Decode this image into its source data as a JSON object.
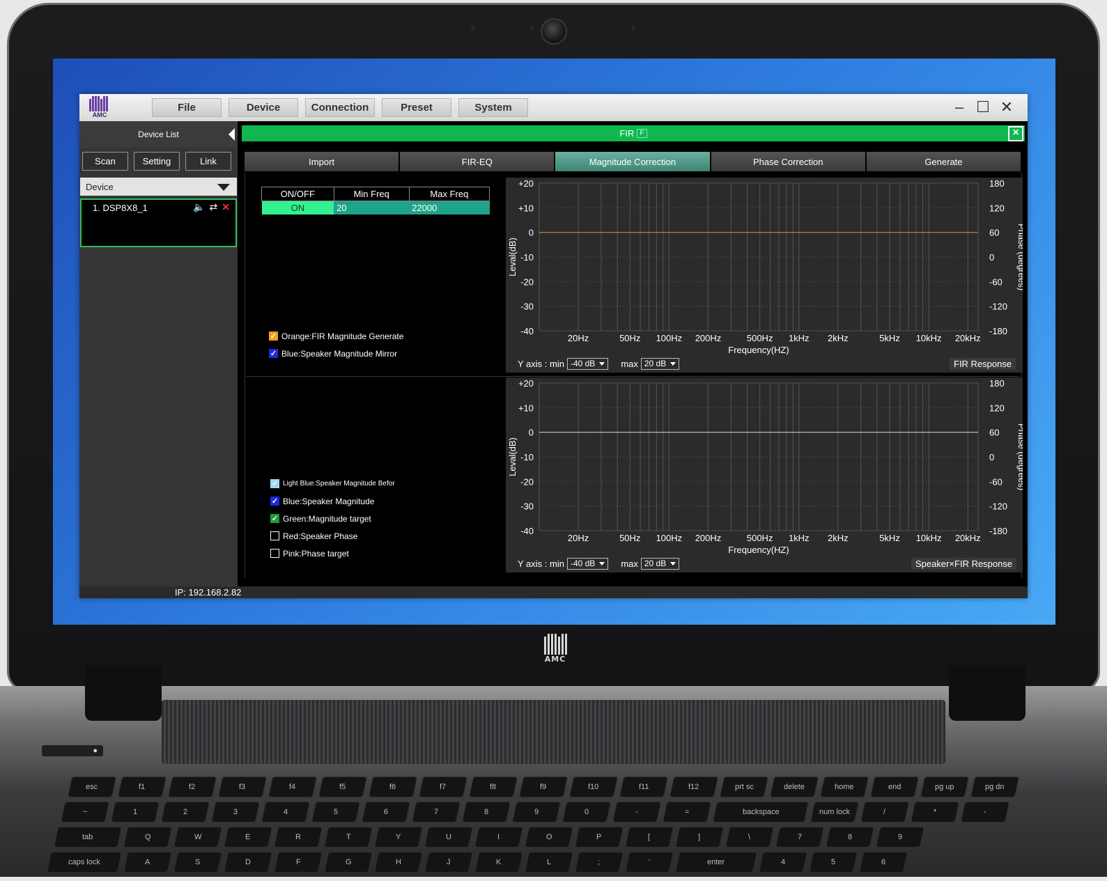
{
  "app": {
    "logo_text": "AMC",
    "menu": [
      "File",
      "Device",
      "Connection",
      "Preset",
      "System"
    ]
  },
  "sidebar": {
    "title": "Device List",
    "buttons": [
      "Scan",
      "Setting",
      "Link"
    ],
    "device_select": "Device",
    "device_name": "1. DSP8X8_1",
    "ip": "IP: 192.168.2.82"
  },
  "fir": {
    "title": "FIR",
    "badge": "F",
    "tabs": [
      "Import",
      "FIR-EQ",
      "Magnitude Correction",
      "Phase Correction",
      "Generate"
    ],
    "active_tab": "Magnitude Correction",
    "table": {
      "headers": [
        "ON/OFF",
        "Min Freq",
        "Max Freq"
      ],
      "row": [
        "ON",
        "20",
        "22000"
      ]
    },
    "legend_top": [
      {
        "label": "Orange:FIR Magnitude Generate",
        "checked": true,
        "color": "#f0a020"
      },
      {
        "label": "Blue:Speaker Magnitude Mirror",
        "checked": true,
        "color": "#1a2be0"
      }
    ],
    "legend_bottom": [
      {
        "label": "Light Blue:Speaker Magnitude Befor",
        "checked": true,
        "color": "#9fd8ee"
      },
      {
        "label": "Blue:Speaker Magnitude",
        "checked": true,
        "color": "#1a2be0"
      },
      {
        "label": "Green:Magnitude target",
        "checked": true,
        "color": "#1c9a3a"
      },
      {
        "label": "Red:Speaker Phase",
        "checked": false,
        "color": "#000000"
      },
      {
        "label": "Pink:Phase target",
        "checked": false,
        "color": "#000000"
      }
    ],
    "y_axis": {
      "label": "Y axis : min",
      "min": "-40 dB",
      "max_label": "max",
      "max": "20 dB"
    },
    "top_response": "FIR Response",
    "bottom_response": "Speaker×FIR Response"
  },
  "chart_data": [
    {
      "type": "line",
      "title": "",
      "xlabel": "Frequency(HZ)",
      "ylabel": "Leval(dB)",
      "y2label": "Phase (degrees)",
      "x_ticks": [
        "20Hz",
        "50Hz",
        "100Hz",
        "200Hz",
        "500Hz",
        "1kHz",
        "2kHz",
        "5kHz",
        "10kHz",
        "20kHz"
      ],
      "x_tick_values": [
        20,
        50,
        100,
        200,
        500,
        1000,
        2000,
        5000,
        10000,
        20000
      ],
      "y_ticks": [
        "+20",
        "+10",
        "0",
        "-10",
        "-20",
        "-30",
        "-40"
      ],
      "y2_ticks": [
        "180",
        "120",
        "60",
        "0",
        "-60",
        "-120",
        "-180"
      ],
      "ylim": [
        -40,
        20
      ],
      "xlim": [
        10,
        24000
      ],
      "x_scale": "log",
      "series": [
        {
          "color": "#d98a1c",
          "x": [
            10,
            24000
          ],
          "y": [
            0,
            0
          ]
        }
      ]
    },
    {
      "type": "line",
      "title": "",
      "xlabel": "Frequency(HZ)",
      "ylabel": "Leval(dB)",
      "y2label": "Phase (degrees)",
      "x_ticks": [
        "20Hz",
        "50Hz",
        "100Hz",
        "200Hz",
        "500Hz",
        "1kHz",
        "2kHz",
        "5kHz",
        "10kHz",
        "20kHz"
      ],
      "x_tick_values": [
        20,
        50,
        100,
        200,
        500,
        1000,
        2000,
        5000,
        10000,
        20000
      ],
      "y_ticks": [
        "+20",
        "+10",
        "0",
        "-10",
        "-20",
        "-30",
        "-40"
      ],
      "y2_ticks": [
        "180",
        "120",
        "60",
        "0",
        "-60",
        "-120",
        "-180"
      ],
      "ylim": [
        -40,
        20
      ],
      "xlim": [
        10,
        24000
      ],
      "x_scale": "log",
      "series": [
        {
          "color": "#b8c8e0",
          "x": [
            10,
            24000
          ],
          "y": [
            0,
            0
          ]
        }
      ]
    }
  ]
}
